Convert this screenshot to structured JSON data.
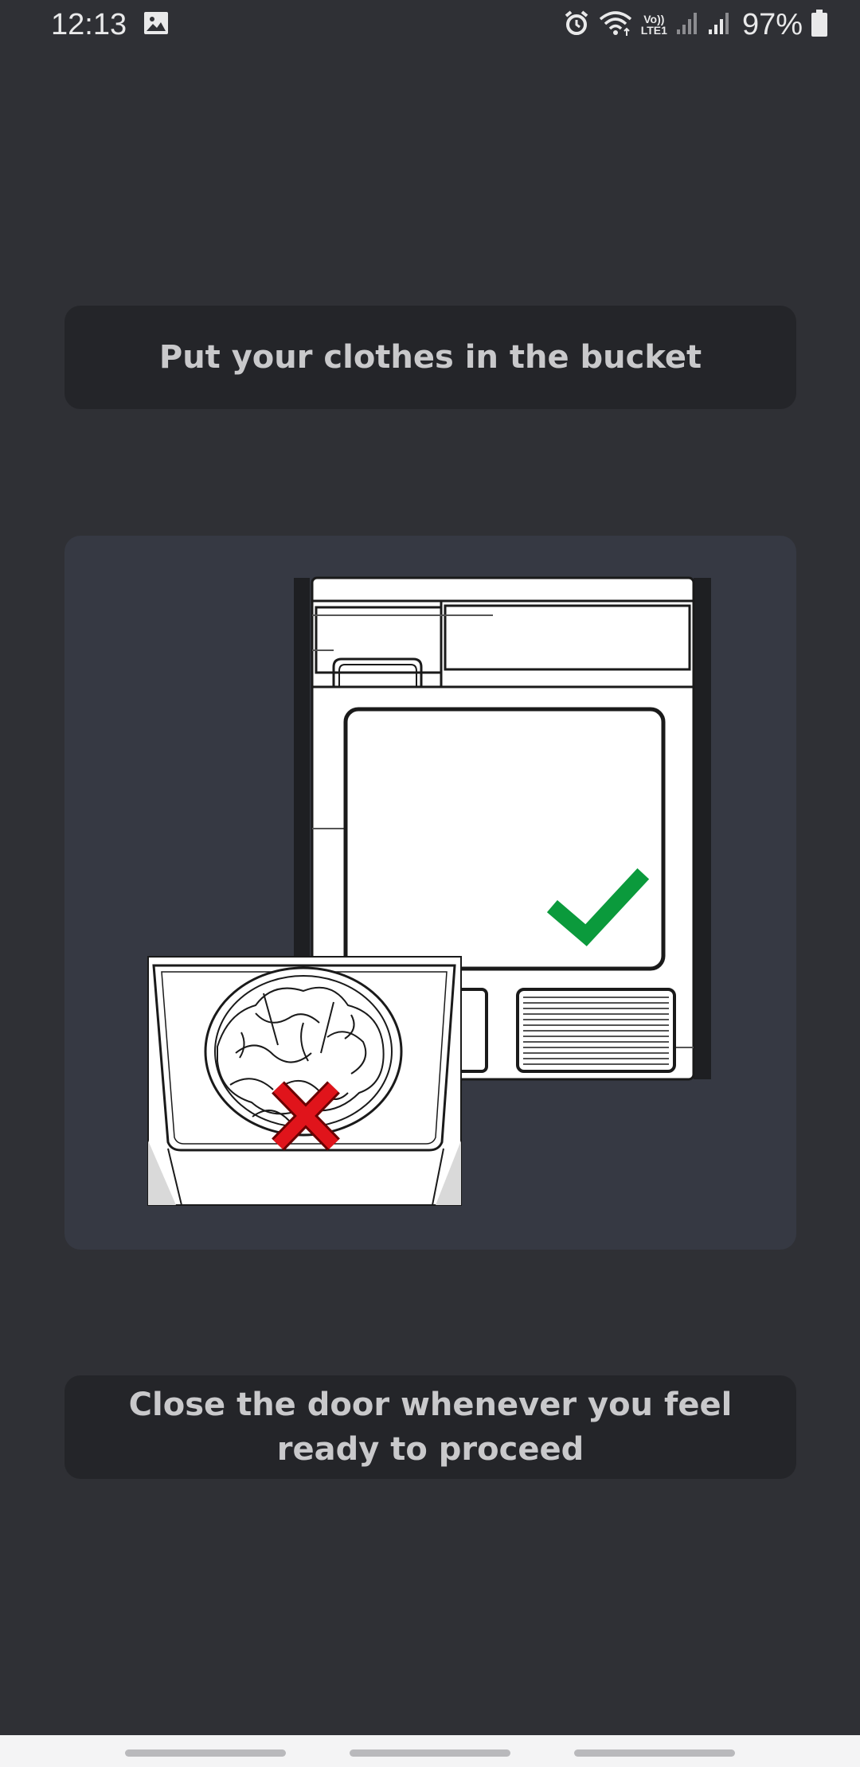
{
  "status_bar": {
    "time": "12:13",
    "battery_percent": "97%",
    "volte_top": "Vo))",
    "volte_bottom": "LTE1",
    "icons": [
      "gallery-icon",
      "alarm-icon",
      "wifi-icon",
      "volte-icon",
      "signal-icon",
      "signal-icon",
      "battery-icon"
    ]
  },
  "instructions": {
    "top": "Put your clothes in the bucket",
    "bottom": "Close the door whenever you feel ready to proceed"
  },
  "illustration": {
    "dryer_front": "dryer-front-illustration",
    "correct_mark": "checkmark-icon",
    "wrong_mark": "cross-icon",
    "inset": "overfilled-drum-illustration",
    "colors": {
      "check": "#0b9a3c",
      "cross": "#e0141b"
    }
  },
  "colors": {
    "background": "#2f3035",
    "banner": "#242529",
    "panel": "#363943",
    "text": "#c9c9cb"
  }
}
